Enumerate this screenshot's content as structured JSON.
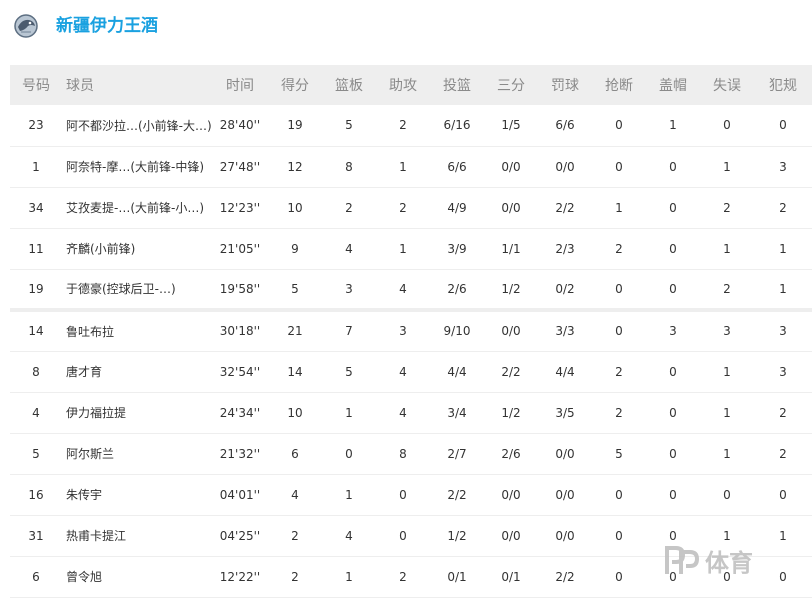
{
  "team": {
    "name": "新疆伊力王酒",
    "logo_icon": "team-logo-icon"
  },
  "columns": [
    "号码",
    "球员",
    "时间",
    "得分",
    "篮板",
    "助攻",
    "投篮",
    "三分",
    "罚球",
    "抢断",
    "盖帽",
    "失误",
    "犯规"
  ],
  "starters": [
    [
      "23",
      "阿不都沙拉…(小前锋-大…)",
      "28'40''",
      "19",
      "5",
      "2",
      "6/16",
      "1/5",
      "6/6",
      "0",
      "1",
      "0",
      "0"
    ],
    [
      "1",
      "阿奈特-摩…(大前锋-中锋)",
      "27'48''",
      "12",
      "8",
      "1",
      "6/6",
      "0/0",
      "0/0",
      "0",
      "0",
      "1",
      "3"
    ],
    [
      "34",
      "艾孜麦提-…(大前锋-小…)",
      "12'23''",
      "10",
      "2",
      "2",
      "4/9",
      "0/0",
      "2/2",
      "1",
      "0",
      "2",
      "2"
    ],
    [
      "11",
      "齐麟(小前锋)",
      "21'05''",
      "9",
      "4",
      "1",
      "3/9",
      "1/1",
      "2/3",
      "2",
      "0",
      "1",
      "1"
    ],
    [
      "19",
      "于德豪(控球后卫-…)",
      "19'58''",
      "5",
      "3",
      "4",
      "2/6",
      "1/2",
      "0/2",
      "0",
      "0",
      "2",
      "1"
    ]
  ],
  "bench": [
    [
      "14",
      "鲁吐布拉",
      "30'18''",
      "21",
      "7",
      "3",
      "9/10",
      "0/0",
      "3/3",
      "0",
      "3",
      "3",
      "3"
    ],
    [
      "8",
      "唐才育",
      "32'54''",
      "14",
      "5",
      "4",
      "4/4",
      "2/2",
      "4/4",
      "2",
      "0",
      "1",
      "3"
    ],
    [
      "4",
      "伊力福拉提",
      "24'34''",
      "10",
      "1",
      "4",
      "3/4",
      "1/2",
      "3/5",
      "2",
      "0",
      "1",
      "2"
    ],
    [
      "5",
      "阿尔斯兰",
      "21'32''",
      "6",
      "0",
      "8",
      "2/7",
      "2/6",
      "0/0",
      "5",
      "0",
      "1",
      "2"
    ],
    [
      "16",
      "朱传宇",
      "04'01''",
      "4",
      "1",
      "0",
      "2/2",
      "0/0",
      "0/0",
      "0",
      "0",
      "0",
      "0"
    ],
    [
      "31",
      "热甫卡提江",
      "04'25''",
      "2",
      "4",
      "0",
      "1/2",
      "0/0",
      "0/0",
      "0",
      "0",
      "1",
      "1"
    ],
    [
      "6",
      "曾令旭",
      "12'22''",
      "2",
      "1",
      "2",
      "0/1",
      "0/1",
      "2/2",
      "0",
      "0",
      "0",
      "0"
    ]
  ],
  "watermark": {
    "logo_text": "PP体育",
    "icon": "pp-sports-watermark-icon"
  },
  "colors": {
    "accent": "#1aa1e0",
    "header_bg": "#eeeeee",
    "header_text": "#8a8a8a",
    "row_text": "#333333"
  }
}
